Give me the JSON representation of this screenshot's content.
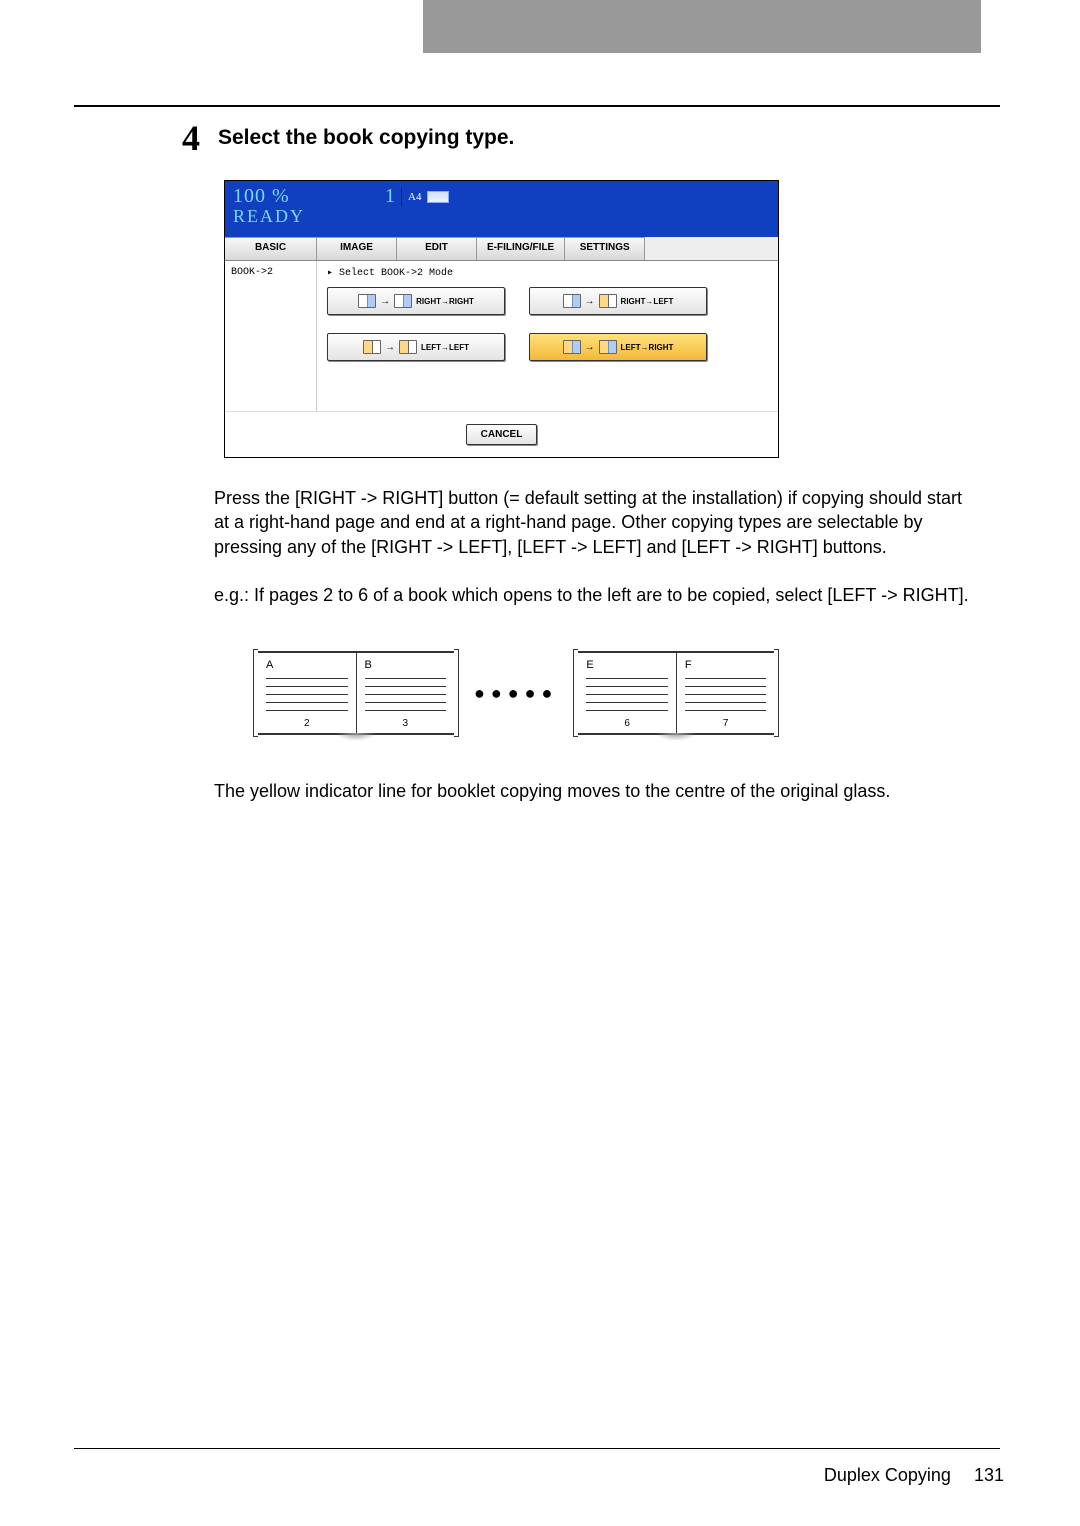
{
  "step": {
    "number": "4",
    "title": "Select the book copying type."
  },
  "ui": {
    "status": {
      "percent": "100",
      "percent_unit": "%",
      "ready": "READY",
      "count": "1",
      "paper": "A4"
    },
    "tabs": [
      "BASIC",
      "IMAGE",
      "EDIT",
      "E-FILING/FILE",
      "SETTINGS"
    ],
    "sidebar": "BOOK->2",
    "select_label": "Select BOOK->2 Mode",
    "modes": {
      "rr": "RIGHT→RIGHT",
      "rl": "RIGHT→LEFT",
      "ll": "LEFT→LEFT",
      "lr": "LEFT→RIGHT"
    },
    "cancel": "CANCEL"
  },
  "para1": "Press the [RIGHT -> RIGHT] button (= default setting at the installation) if copying should start at a right-hand page and end at a right-hand page. Other copying types are selectable by pressing any of the [RIGHT -> LEFT], [LEFT -> LEFT] and [LEFT -> RIGHT] buttons.",
  "para2": "e.g.: If pages 2 to 6 of a book which opens to the left are to be copied, select [LEFT -> RIGHT].",
  "diagram": {
    "book1": {
      "left_label": "A",
      "right_label": "B",
      "left_num": "2",
      "right_num": "3"
    },
    "book2": {
      "left_label": "E",
      "right_label": "F",
      "left_num": "6",
      "right_num": "7"
    }
  },
  "para3": "The yellow indicator line for booklet copying moves to the centre of the original glass.",
  "footer": {
    "section": "Duplex Copying",
    "page": "131"
  }
}
